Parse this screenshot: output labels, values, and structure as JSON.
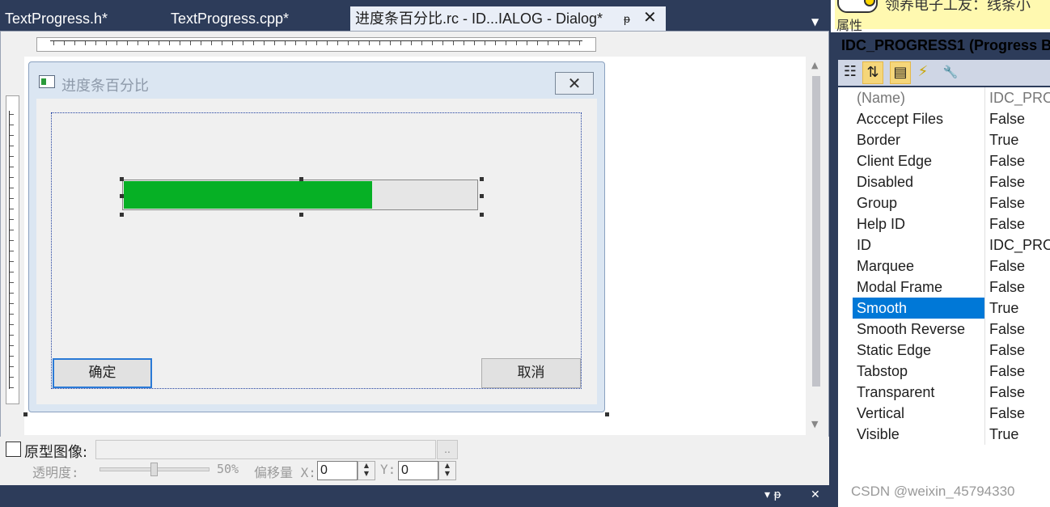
{
  "tabs": [
    {
      "label": "TextProgress.h*"
    },
    {
      "label": "TextProgress.cpp*"
    },
    {
      "label": "进度条百分比.rc - ID...IALOG - Dialog*",
      "pin": "ᵽ",
      "close": "✕"
    }
  ],
  "tab_dropdown": "▼",
  "dialog": {
    "title": "进度条百分比",
    "close": "✕",
    "ok": "确定",
    "cancel": "取消",
    "progress_fraction": 0.7,
    "progress_color": "#06b025"
  },
  "bottom": {
    "proto_label": "原型图像:",
    "browse": "..",
    "opacity_label": "透明度:",
    "opacity_value": "50%",
    "offset_label": "偏移量 X:",
    "x_value": "0",
    "y_label": "Y:",
    "y_value": "0"
  },
  "statusbar": {
    "pin": "▾ ᵽ",
    "close": "✕"
  },
  "note": {
    "text": "领养电子工友：线条小"
  },
  "properties": {
    "header": "属性",
    "title": "IDC_PROGRESS1 (Progress B",
    "toolbar": [
      {
        "icon": "categorized-icon",
        "glyph": "☷"
      },
      {
        "icon": "alphabetical-icon",
        "glyph": "⇅"
      },
      {
        "icon": "properties-icon",
        "glyph": "▤"
      },
      {
        "icon": "events-icon",
        "glyph": "⚡"
      },
      {
        "icon": "wrench-icon",
        "glyph": "🔧"
      }
    ],
    "rows": [
      {
        "name": "(Name)",
        "value": "IDC_PRO"
      },
      {
        "name": "Acccept Files",
        "value": "False"
      },
      {
        "name": "Border",
        "value": "True"
      },
      {
        "name": "Client Edge",
        "value": "False"
      },
      {
        "name": "Disabled",
        "value": "False"
      },
      {
        "name": "Group",
        "value": "False"
      },
      {
        "name": "Help ID",
        "value": "False"
      },
      {
        "name": "ID",
        "value": "IDC_PRO"
      },
      {
        "name": "Marquee",
        "value": "False"
      },
      {
        "name": "Modal Frame",
        "value": "False"
      },
      {
        "name": "Smooth",
        "value": "True"
      },
      {
        "name": "Smooth Reverse",
        "value": "False"
      },
      {
        "name": "Static Edge",
        "value": "False"
      },
      {
        "name": "Tabstop",
        "value": "False"
      },
      {
        "name": "Transparent",
        "value": "False"
      },
      {
        "name": "Vertical",
        "value": "False"
      },
      {
        "name": "Visible",
        "value": "True"
      }
    ],
    "selected": "Smooth"
  },
  "watermark": "CSDN @weixin_45794330"
}
